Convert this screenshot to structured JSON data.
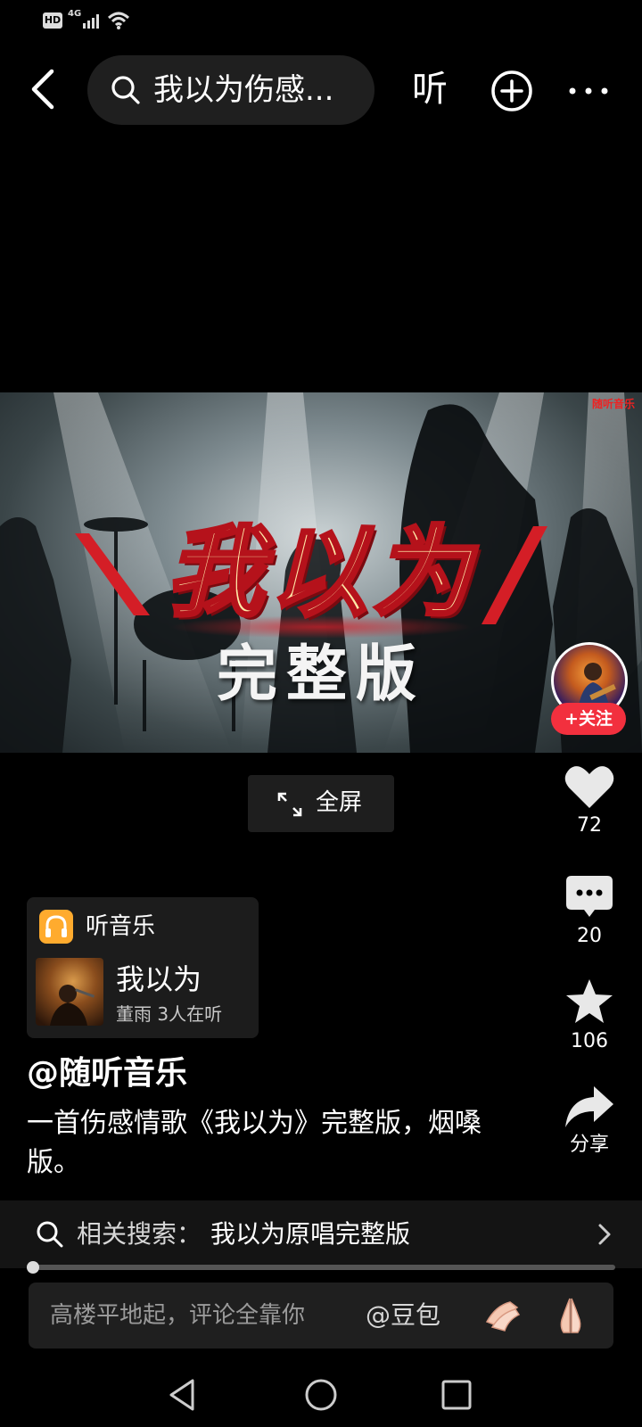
{
  "status_bar": {
    "hd": "HD",
    "network": "4G"
  },
  "top_bar": {
    "search_query": "我以为伤感...",
    "listen_label": "听"
  },
  "video": {
    "title": "我以为",
    "subtitle": "完整版",
    "watermark": "随听音乐"
  },
  "follow_label": "+关注",
  "fullscreen_label": "全屏",
  "actions": {
    "likes": "72",
    "comments": "20",
    "favorites": "106",
    "share_label": "分享"
  },
  "music_card": {
    "app_name": "听音乐",
    "song_title": "我以为",
    "artist_listeners": "董雨 3人在听"
  },
  "author": "@随听音乐",
  "description": "一首伤感情歌《我以为》完整版，烟嗓版。",
  "related_search": {
    "prefix": "相关搜索：",
    "query": "我以为原唱完整版"
  },
  "playback_progress": 0.0,
  "comment": {
    "placeholder": "高楼平地起，评论全靠你",
    "mention": "@豆包"
  },
  "colors": {
    "accent_red": "#f2303e",
    "music_orange": "#ffab2e"
  },
  "icons": [
    "back-arrow-icon",
    "search-icon",
    "add-circle-icon",
    "more-dots-icon",
    "fullscreen-icon",
    "heart-icon",
    "comment-icon",
    "star-icon",
    "share-icon",
    "headphones-icon",
    "chevron-right-icon",
    "clap-emoji-icon",
    "pray-emoji-icon",
    "nav-back-icon",
    "nav-home-icon",
    "nav-recents-icon"
  ]
}
